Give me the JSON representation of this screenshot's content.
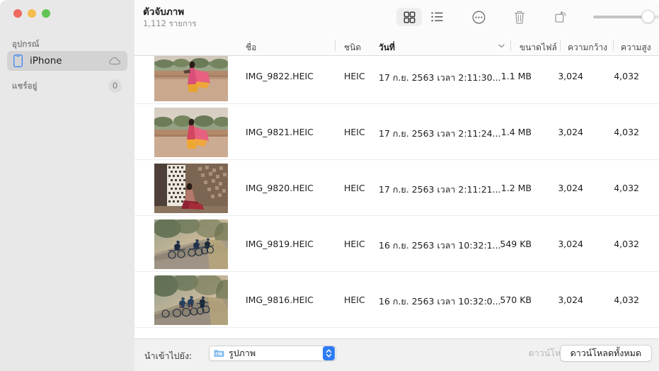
{
  "window": {
    "title": "ตัวจับภาพ",
    "subtitle": "1,112 รายการ",
    "traffic_lights": {
      "close": "close-button",
      "minimize": "minimize-button",
      "maximize": "maximize-button",
      "close_color": "#ec6a5f",
      "minimize_color": "#f4bd4f",
      "maximize_color": "#61c454"
    }
  },
  "sidebar": {
    "devices_header": "อุปกรณ์",
    "shared_header": "แชร์อยู่",
    "shared_badge": "0",
    "device": {
      "label": "iPhone",
      "icon": "iphone-icon",
      "status_icon": "cloud-icon",
      "selected": true
    }
  },
  "toolbar": {
    "buttons": [
      {
        "name": "grid-view-button",
        "icon": "grid-icon",
        "selected": true
      },
      {
        "name": "list-view-button",
        "icon": "list-icon",
        "selected": false
      },
      {
        "name": "more-options-button",
        "icon": "ellipsis-circle-icon",
        "selected": false
      },
      {
        "name": "delete-button",
        "icon": "trash-icon",
        "selected": false
      },
      {
        "name": "rotate-button",
        "icon": "rotate-icon",
        "selected": false
      }
    ],
    "zoom_slider": {
      "name": "thumbnail-size-slider",
      "value_percent": 78
    }
  },
  "table": {
    "columns": [
      {
        "key": "name",
        "label": "ชื่อ",
        "sorted": false
      },
      {
        "key": "kind",
        "label": "ชนิด",
        "sorted": false
      },
      {
        "key": "date",
        "label": "วันที่",
        "sorted": true,
        "sort_direction": "descending"
      },
      {
        "key": "size",
        "label": "ขนาดไฟล์",
        "sorted": false
      },
      {
        "key": "width",
        "label": "ความกว้าง",
        "sorted": false
      },
      {
        "key": "height",
        "label": "ความสูง",
        "sorted": false
      }
    ],
    "rows": [
      {
        "name": "IMG_9822.HEIC",
        "kind": "HEIC",
        "date": "17 ก.ย. 2563 เวลา 2:11:30...",
        "size": "1.1 MB",
        "width": "3,024",
        "height": "4,032",
        "thumbnail": "woman-in-pink-sari-at-terrace"
      },
      {
        "name": "IMG_9821.HEIC",
        "kind": "HEIC",
        "date": "17 ก.ย. 2563 เวลา 2:11:24...",
        "size": "1.4 MB",
        "width": "3,024",
        "height": "4,032",
        "thumbnail": "woman-in-pink-sari-at-terrace"
      },
      {
        "name": "IMG_9820.HEIC",
        "kind": "HEIC",
        "date": "17 ก.ย. 2563 เวลา 2:11:21...",
        "size": "1.2 MB",
        "width": "3,024",
        "height": "4,032",
        "thumbnail": "woman-seated-by-latticed-window"
      },
      {
        "name": "IMG_9819.HEIC",
        "kind": "HEIC",
        "date": "16 ก.ย. 2563 เวลา 10:32:1...",
        "size": "549 KB",
        "width": "3,024",
        "height": "4,032",
        "thumbnail": "cyclists-on-misty-road"
      },
      {
        "name": "IMG_9816.HEIC",
        "kind": "HEIC",
        "date": "16 ก.ย. 2563 เวลา 10:32:0...",
        "size": "570 KB",
        "width": "3,024",
        "height": "4,032",
        "thumbnail": "cyclists-on-misty-road"
      }
    ]
  },
  "bottom_bar": {
    "import_label": "นำเข้าไปยัง:",
    "import_destination": "รูปภาพ",
    "import_destination_icon": "folder-icon",
    "download_button": "ดาวน์โหลด",
    "download_button_enabled": false,
    "download_all_button": "ดาวน์โหลดทั้งหมด",
    "download_all_button_enabled": true,
    "accent_color": "#2f7cf6"
  }
}
